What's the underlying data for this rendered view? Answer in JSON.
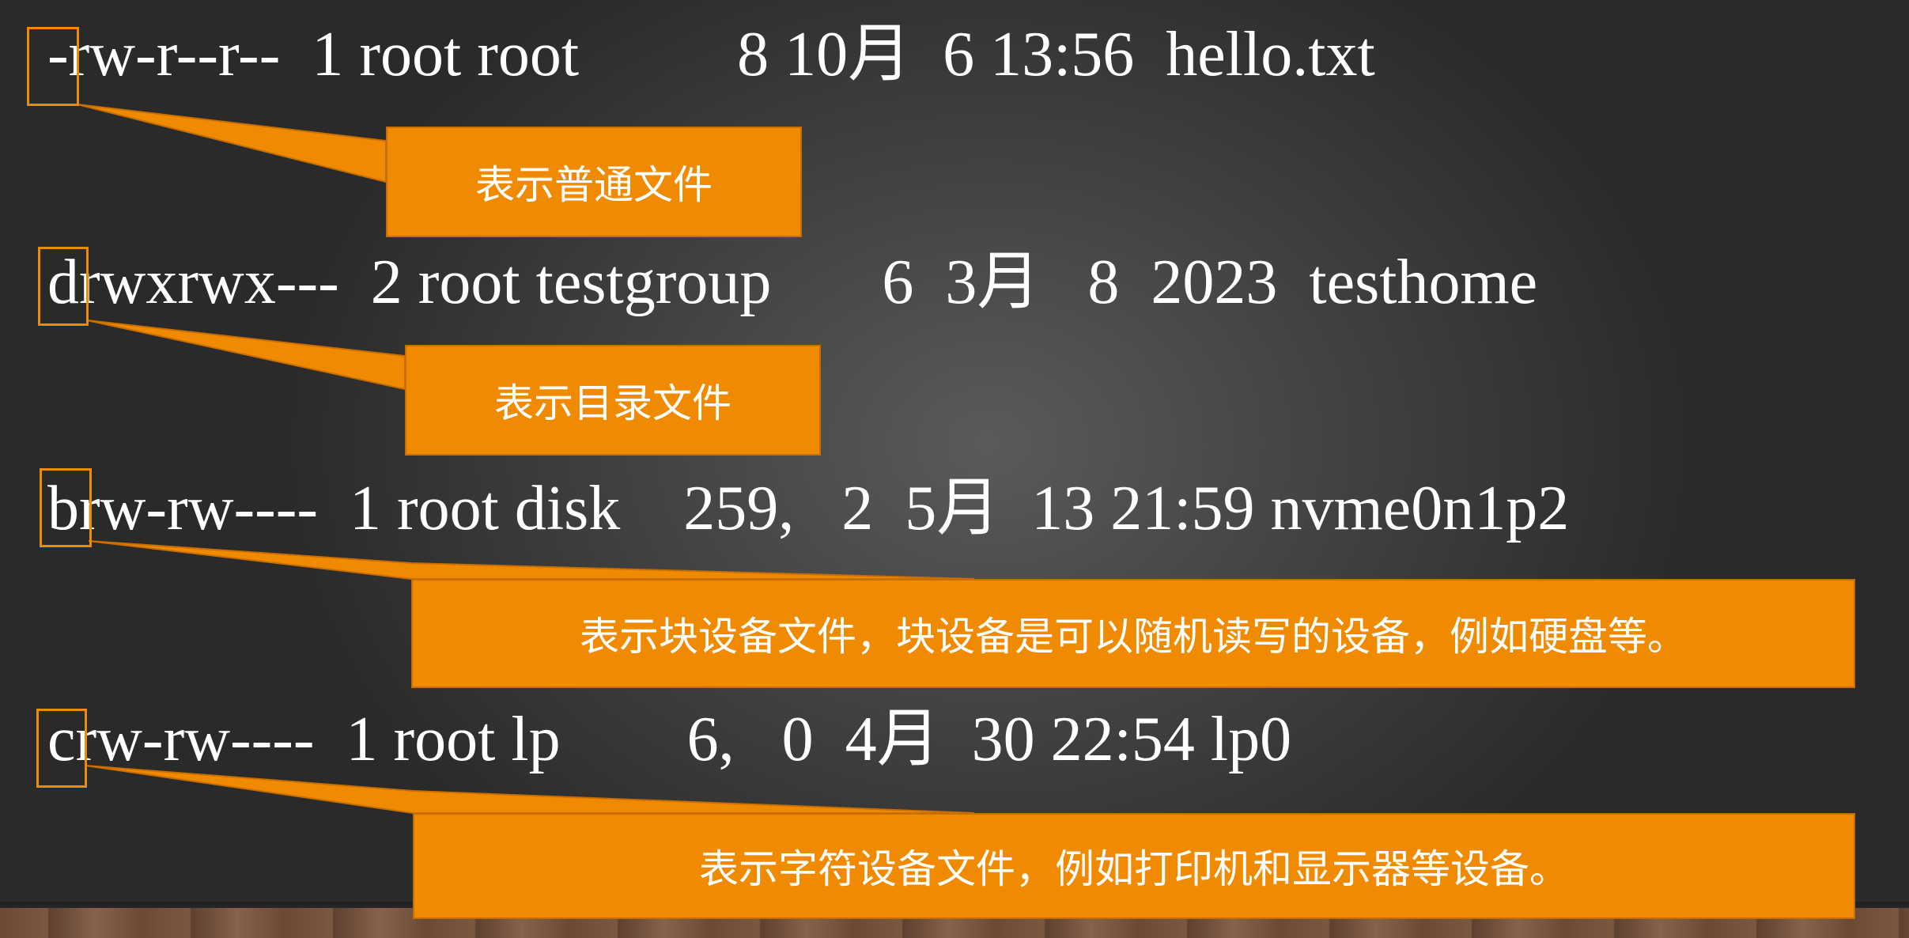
{
  "listing": [
    {
      "text": "-rw-r--r--  1 root root          8 10月  6 13:56  hello.txt"
    },
    {
      "text": "drwxrwx---  2 root testgroup       6  3月   8  2023  testhome"
    },
    {
      "text": "brw-rw----  1 root disk    259,   2  5月  13 21:59 nvme0n1p2"
    },
    {
      "text": "crw-rw----  1 root lp        6,   0  4月  30 22:54 lp0"
    }
  ],
  "callouts": [
    {
      "text": "表示普通文件"
    },
    {
      "text": "表示目录文件"
    },
    {
      "text": "表示块设备文件，块设备是可以随机读写的设备，例如硬盘等。"
    },
    {
      "text": "表示字符设备文件，例如打印机和显示器等设备。"
    }
  ],
  "colors": {
    "accent": "#f08a00",
    "text": "#ffffff",
    "background": "#3b3b3b"
  }
}
